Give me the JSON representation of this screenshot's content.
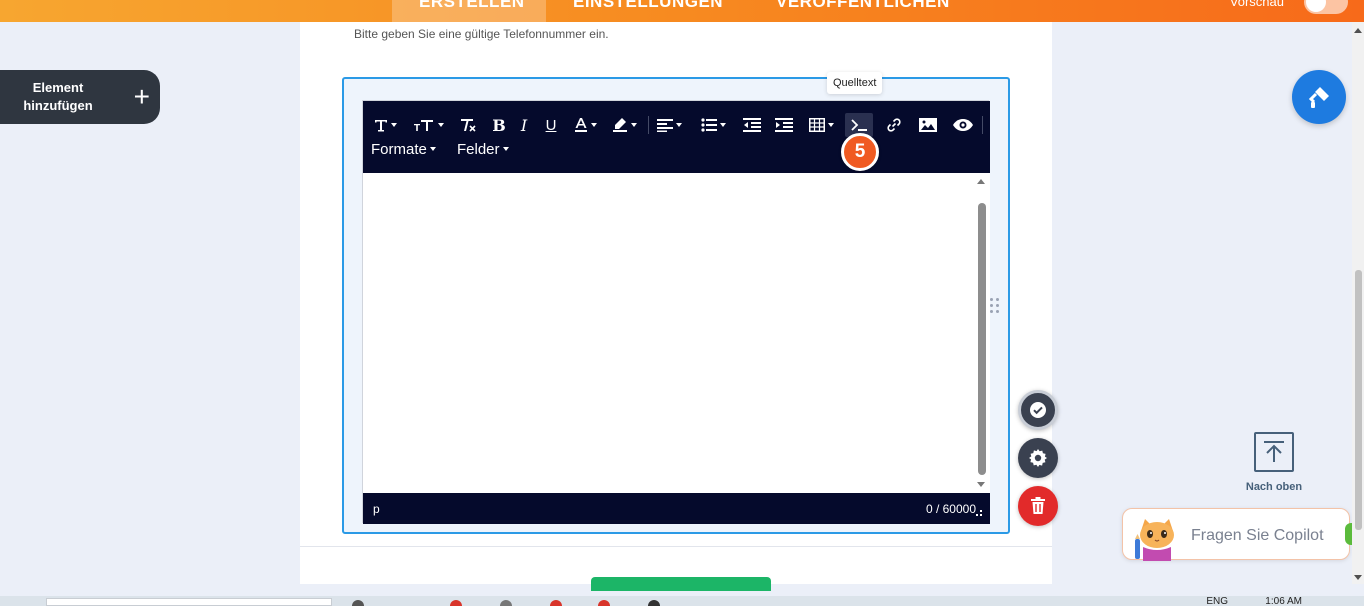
{
  "topbar": {
    "tabs": [
      {
        "label": "ERSTELLEN",
        "active": true
      },
      {
        "label": "EINSTELLUNGEN",
        "active": false
      },
      {
        "label": "VERÖFFENTLICHEN",
        "active": false
      }
    ],
    "preview_label": "Vorschau"
  },
  "page": {
    "hint": "Bitte geben Sie eine gültige Telefonnummer ein."
  },
  "add_element": {
    "label": "Element hinzufügen",
    "plus": "+"
  },
  "editor": {
    "tooltip": "Quelltext",
    "step_badge": "5",
    "dropdowns": {
      "formats": "Formate",
      "fields": "Felder"
    },
    "status_path": "p",
    "char_count": "0 / 60000"
  },
  "to_top": {
    "label": "Nach oben"
  },
  "copilot": {
    "label": "Fragen Sie Copilot"
  },
  "taskbar": {
    "lang": "ENG",
    "time": "1:06 AM"
  },
  "colors": {
    "accent_orange": "#f78a20",
    "editor_dark": "#050a2c",
    "border_blue": "#2b9ae6",
    "badge_orange": "#f05a22",
    "fab_blue": "#1e7be0",
    "delete_red": "#e22a2a"
  }
}
